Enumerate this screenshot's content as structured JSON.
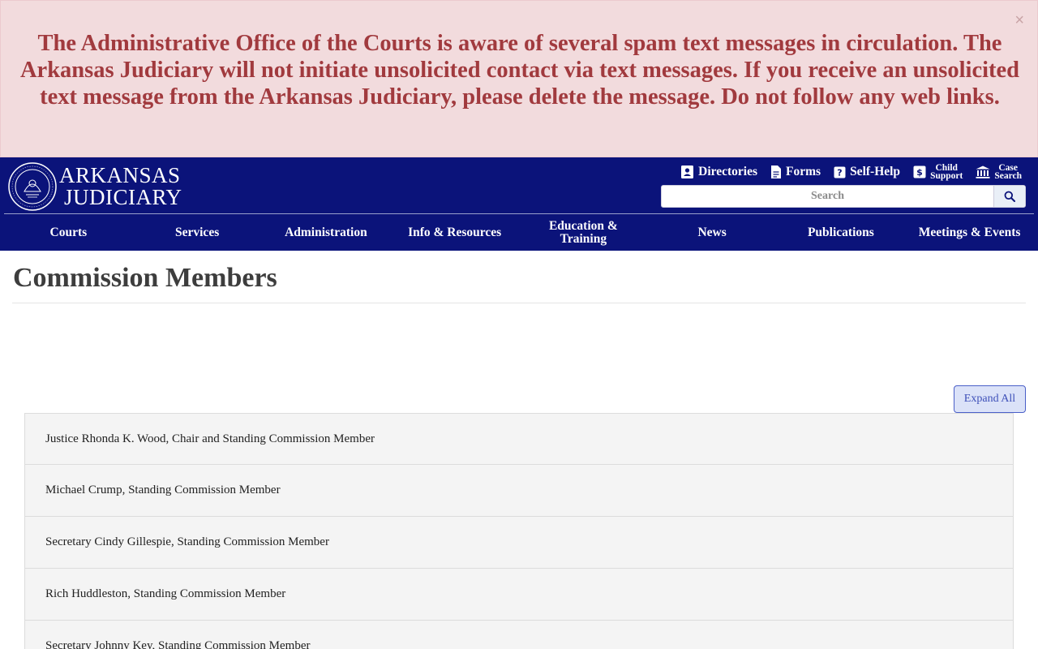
{
  "alert": {
    "message": "The Administrative Office of the Courts is aware of several spam text messages in circulation. The Arkansas Judiciary will not initiate unsolicited contact via text messages. If you receive an unsolicited text message from the Arkansas Judiciary, please delete the message. Do not follow any web links.",
    "close_label": "×"
  },
  "header": {
    "logo_line1": "ARKANSAS",
    "logo_line2": "JUDICIARY",
    "utility": {
      "directories": "Directories",
      "forms": "Forms",
      "self_help": "Self-Help",
      "child_support_1": "Child",
      "child_support_2": "Support",
      "case_search_1": "Case",
      "case_search_2": "Search"
    },
    "search_placeholder": "Search"
  },
  "nav": {
    "courts": "Courts",
    "services": "Services",
    "administration": "Administration",
    "info_resources": "Info & Resources",
    "education_1": "Education &",
    "education_2": "Training",
    "news": "News",
    "publications": "Publications",
    "meetings_events": "Meetings & Events"
  },
  "main": {
    "title": "Commission Members",
    "expand_all": "Expand All",
    "members": [
      "Justice Rhonda K. Wood, Chair and Standing Commission Member",
      "Michael Crump, Standing Commission Member",
      "Secretary Cindy Gillespie, Standing Commission Member",
      "Rich Huddleston, Standing Commission Member",
      "Secretary Johnny Key, Standing Commission Member"
    ]
  },
  "colors": {
    "header_bg": "#0b137a",
    "alert_bg": "#f2dbdd",
    "alert_text": "#a13a3e"
  },
  "icons": [
    "directory-icon",
    "forms-icon",
    "self-help-icon",
    "child-support-icon",
    "case-search-icon",
    "search-icon",
    "close-icon",
    "seal-logo-icon"
  ]
}
